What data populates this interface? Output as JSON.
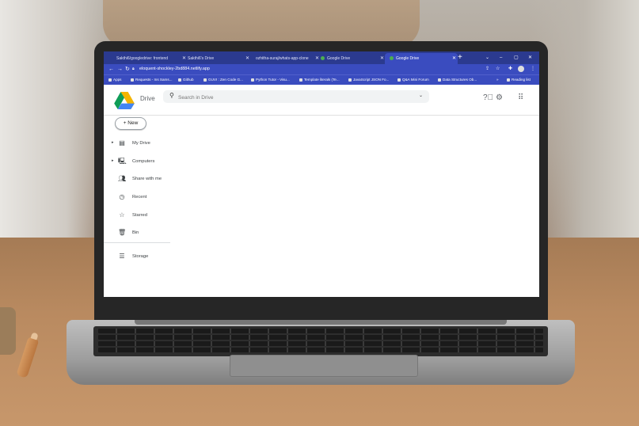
{
  "browser": {
    "tabs": [
      {
        "label": "Sakthi6/googledrive: frontend"
      },
      {
        "label": "Sakthi6's Drive"
      },
      {
        "label": "ozhitha-suraj/whats-app-clone"
      },
      {
        "label": "Google Drive"
      },
      {
        "label": "Google Drive",
        "active": true
      }
    ],
    "new_tab": "+",
    "window_controls": {
      "minimize": "–",
      "maximize": "▢",
      "close": "✕",
      "expand": "⌄"
    },
    "url": "eloquent-shockley-2bd884.netlify.app",
    "bookmarks": [
      {
        "label": "Apps"
      },
      {
        "label": "Requests - Ins Sams..."
      },
      {
        "label": "Github"
      },
      {
        "label": "GUVI : Zen Code G..."
      },
      {
        "label": "Python Tutor - Visu..."
      },
      {
        "label": "Template literals (Te..."
      },
      {
        "label": "JavaScript JSON Fo..."
      },
      {
        "label": "Q&A Mini Forum"
      },
      {
        "label": "Data Structures Ob..."
      },
      {
        "label": "Reading list"
      }
    ],
    "bookmarks_more": "»"
  },
  "drive": {
    "brand": "Drive",
    "search_placeholder": "Search in Drive",
    "new_button": "+ New",
    "nav": [
      {
        "label": "My Drive",
        "icon": "my-drive-icon",
        "expandable": true
      },
      {
        "label": "Computers",
        "icon": "computers-icon",
        "expandable": true
      },
      {
        "label": "Share with me",
        "icon": "shared-icon",
        "expandable": false
      },
      {
        "label": "Recent",
        "icon": "clock-icon",
        "expandable": false
      },
      {
        "label": "Starred",
        "icon": "star-icon",
        "expandable": false
      },
      {
        "label": "Bin",
        "icon": "bin-icon",
        "expandable": false
      }
    ],
    "storage_label": "Storage"
  },
  "colors": {
    "chrome_dark": "#2b3a8f",
    "chrome": "#3a4cbf",
    "drive_green": "#0f9d58",
    "drive_yellow": "#f4b400",
    "drive_blue": "#4285f4"
  }
}
